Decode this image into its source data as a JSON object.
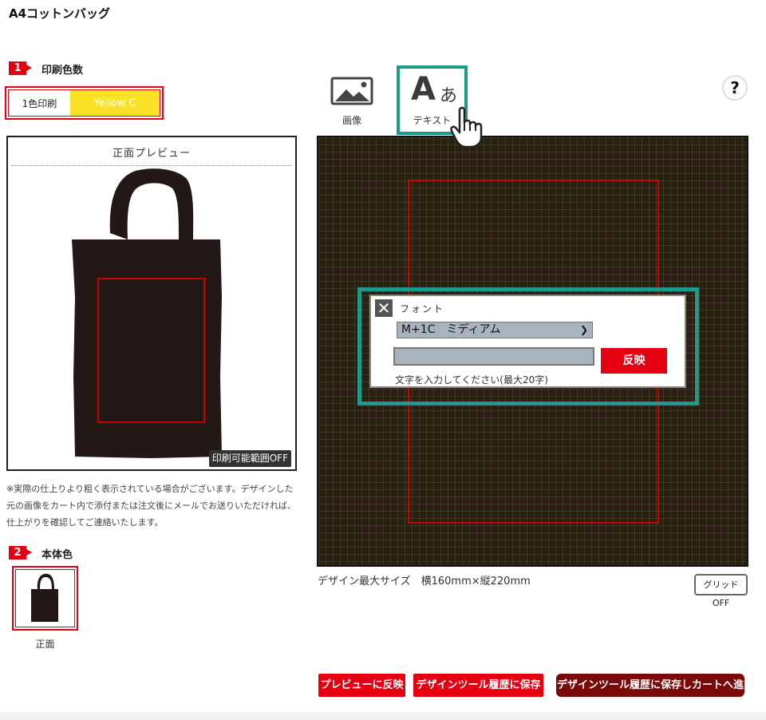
{
  "page": {
    "title": "A4コットンバッグ"
  },
  "step1": {
    "number": "1",
    "label": "印刷色数",
    "color_count": "1色印刷",
    "ink_color": "Yellow C",
    "ink_hex": "#fbe227"
  },
  "preview": {
    "title": "正面プレビュー",
    "print_area_toggle": "印刷可能範囲OFF",
    "note": "※実際の仕上りより粗く表示されている場合がございます。デザインした元の画像をカート内で添付または注文後にメールでお送りいただければ、仕上がりを確認してご連絡いたします。"
  },
  "step2": {
    "number": "2",
    "label": "本体色",
    "swatch_label": "正面"
  },
  "tools": {
    "image_label": "画像",
    "text_label": "テキスト",
    "text_glyph_latin": "A",
    "text_glyph_kana": "あ",
    "help": "?"
  },
  "dialog": {
    "close": "✕",
    "font_label": "フォント",
    "font_selected": "M+1C　ミディアム",
    "text_value": "",
    "apply": "反映",
    "hint": "文字を入力してください(最大20字)"
  },
  "canvas": {
    "size_info": "デザイン最大サイズ　横160mm×縦220mm",
    "grid_toggle": "グリッドOFF"
  },
  "actions": {
    "preview_apply": "プレビューに反映",
    "save_history": "デザインツール履歴に保存",
    "save_and_cart": "デザインツール履歴に保存しカートへ進む"
  },
  "colors": {
    "accent_red": "#e60012",
    "teal": "#1d9a8b",
    "bag": "#231815"
  }
}
